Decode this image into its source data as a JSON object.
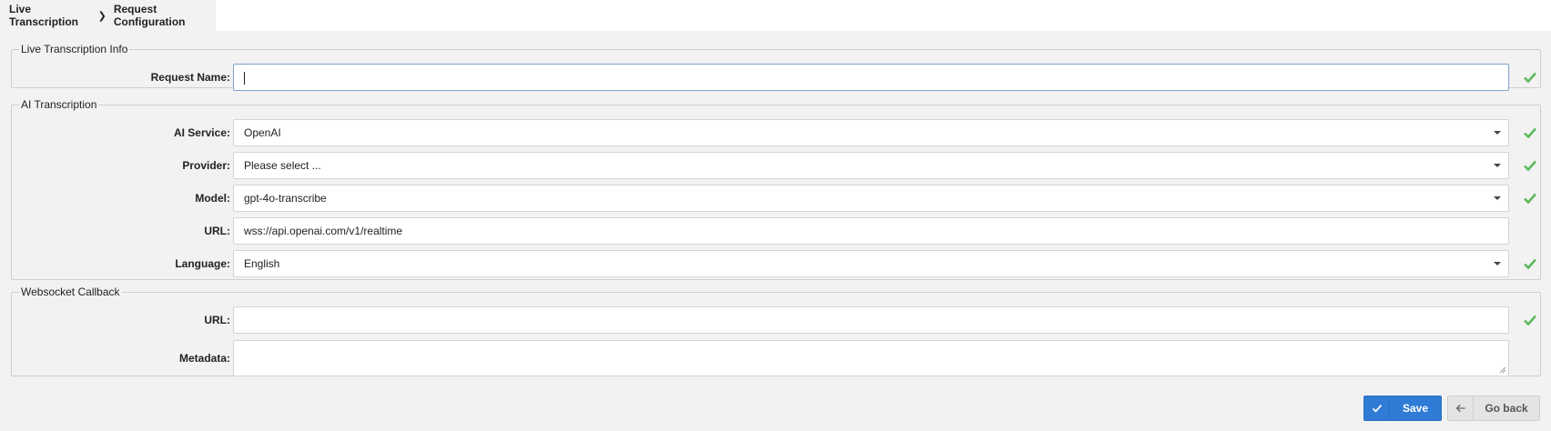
{
  "breadcrumb": {
    "parent": "Live Transcription",
    "current": "Request Configuration"
  },
  "colors": {
    "accent": "#2f7bd6",
    "valid": "#5cb85c",
    "background": "#f2f2f2"
  },
  "sections": {
    "info": {
      "legend": "Live Transcription Info",
      "request_name": {
        "label": "Request Name:",
        "value": ""
      }
    },
    "ai": {
      "legend": "AI Transcription",
      "service": {
        "label": "AI Service:",
        "value": "OpenAI"
      },
      "provider": {
        "label": "Provider:",
        "value": "Please select ..."
      },
      "model": {
        "label": "Model:",
        "value": "gpt-4o-transcribe"
      },
      "url": {
        "label": "URL:",
        "value": "wss://api.openai.com/v1/realtime"
      },
      "language": {
        "label": "Language:",
        "value": "English"
      }
    },
    "websocket": {
      "legend": "Websocket Callback",
      "url": {
        "label": "URL:",
        "value": ""
      },
      "metadata": {
        "label": "Metadata:",
        "value": ""
      }
    }
  },
  "icons": {
    "valid": "check-icon",
    "dropdown": "chevron-down-icon",
    "save": "check-icon",
    "back": "arrow-left-icon"
  },
  "buttons": {
    "save": "Save",
    "back": "Go back"
  }
}
